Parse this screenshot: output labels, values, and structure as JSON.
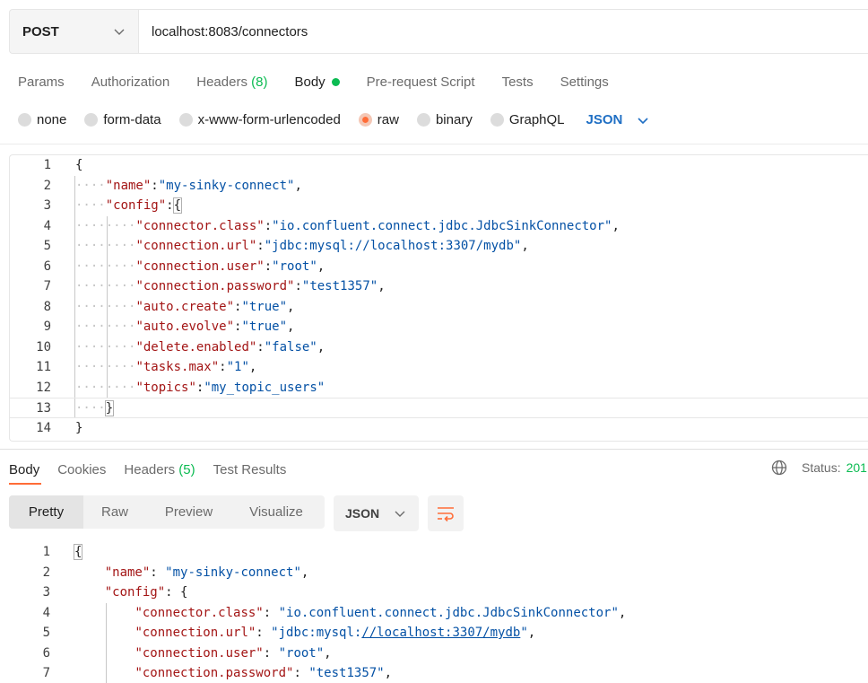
{
  "request": {
    "method": "POST",
    "url": "localhost:8083/connectors",
    "tabs": [
      {
        "label": "Params"
      },
      {
        "label": "Authorization"
      },
      {
        "label": "Headers",
        "count": "(8)"
      },
      {
        "label": "Body"
      },
      {
        "label": "Pre-request Script"
      },
      {
        "label": "Tests"
      },
      {
        "label": "Settings"
      }
    ],
    "body_types": [
      "none",
      "form-data",
      "x-www-form-urlencoded",
      "raw",
      "binary",
      "GraphQL"
    ],
    "selected_body_type": "raw",
    "language": "JSON"
  },
  "request_body": {
    "line_numbers": [
      "1",
      "2",
      "3",
      "4",
      "5",
      "6",
      "7",
      "8",
      "9",
      "10",
      "11",
      "12",
      "13",
      "14"
    ],
    "open_brace": "{",
    "close_brace": "}",
    "name_key": "\"name\"",
    "name_value": "\"my-sinky-connect\"",
    "config_key": "\"config\"",
    "config_open": "{",
    "config_close": "}",
    "config": [
      {
        "key": "\"connector.class\"",
        "value": "\"io.confluent.connect.jdbc.JdbcSinkConnector\""
      },
      {
        "key": "\"connection.url\"",
        "value": "\"jdbc:mysql://localhost:3307/mydb\""
      },
      {
        "key": "\"connection.user\"",
        "value": "\"root\""
      },
      {
        "key": "\"connection.password\"",
        "value": "\"test1357\""
      },
      {
        "key": "\"auto.create\"",
        "value": "\"true\""
      },
      {
        "key": "\"auto.evolve\"",
        "value": "\"true\""
      },
      {
        "key": "\"delete.enabled\"",
        "value": "\"false\""
      },
      {
        "key": "\"tasks.max\"",
        "value": "\"1\""
      },
      {
        "key": "\"topics\"",
        "value": "\"my_topic_users\""
      }
    ]
  },
  "response": {
    "tabs": [
      {
        "label": "Body"
      },
      {
        "label": "Cookies"
      },
      {
        "label": "Headers",
        "count": "(5)"
      },
      {
        "label": "Test Results"
      }
    ],
    "status_label": "Status:",
    "status_value": "201",
    "view_modes": [
      "Pretty",
      "Raw",
      "Preview",
      "Visualize"
    ],
    "format": "JSON",
    "line_numbers": [
      "1",
      "2",
      "3",
      "4",
      "5",
      "6",
      "7"
    ],
    "open_brace": "{",
    "name_key": "\"name\"",
    "name_value": "\"my-sinky-connect\"",
    "config_key": "\"config\"",
    "config_open": "{",
    "config": [
      {
        "key": "\"connector.class\"",
        "value": "\"io.confluent.connect.jdbc.JdbcSinkConnector\""
      },
      {
        "key": "\"connection.url\"",
        "value_prefix": "\"jdbc:mysql:",
        "value_link": "//localhost:3307/mydb",
        "value_suffix": "\""
      },
      {
        "key": "\"connection.user\"",
        "value": "\"root\""
      },
      {
        "key": "\"connection.password\"",
        "value": "\"test1357\""
      }
    ]
  },
  "colors": {
    "accent": "#ff6c37",
    "success": "#0cbb52",
    "json_key": "#a31515",
    "json_string": "#0451a5",
    "link_blue": "#1f6fc4"
  }
}
